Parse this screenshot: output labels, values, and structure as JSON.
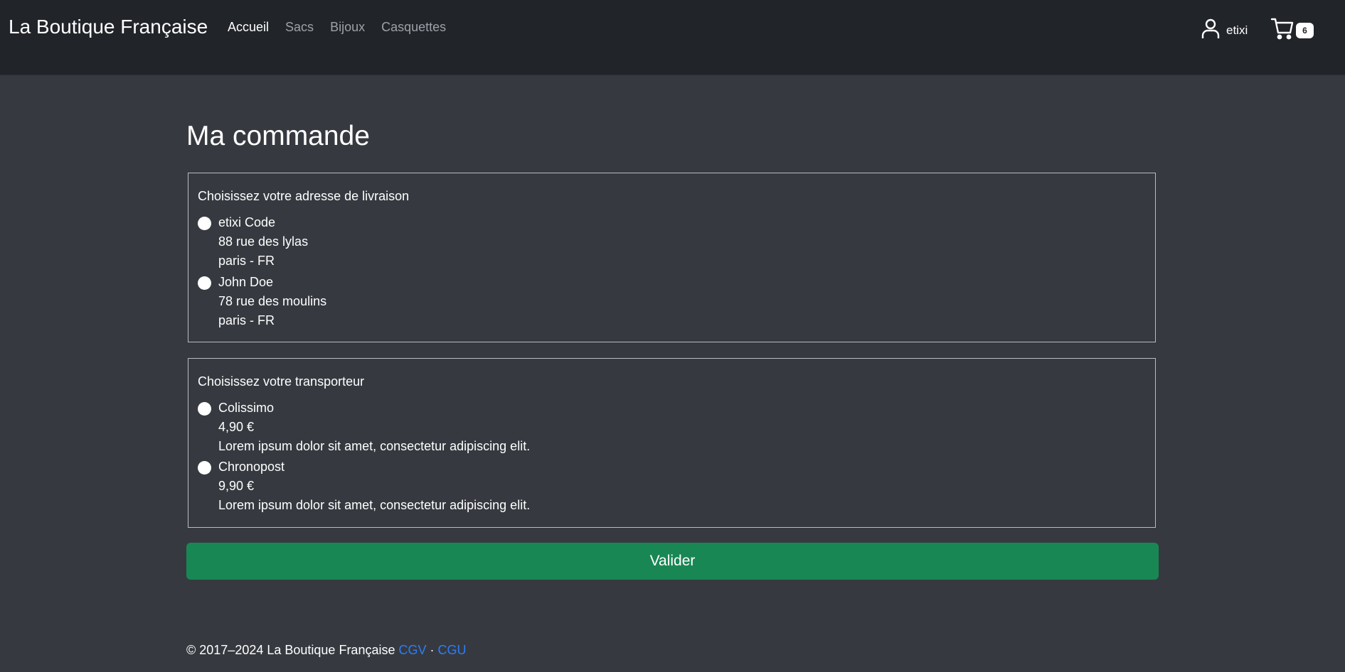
{
  "navbar": {
    "brand": "La Boutique Française",
    "links": [
      "Accueil",
      "Sacs",
      "Bijoux",
      "Casquettes"
    ],
    "account_name": "etixi",
    "cart_count": "6"
  },
  "main": {
    "title": "Ma commande",
    "address_section": {
      "label": "Choisissez votre adresse de livraison",
      "options": [
        {
          "line1": "etixi Code",
          "line2": "88 rue des lylas",
          "line3": "paris - FR"
        },
        {
          "line1": "John Doe",
          "line2": "78 rue des moulins",
          "line3": "paris - FR"
        }
      ]
    },
    "carrier_section": {
      "label": "Choisissez votre transporteur",
      "options": [
        {
          "name": "Colissimo",
          "price": "4,90 €",
          "description": "Lorem ipsum dolor sit amet, consectetur adipiscing elit."
        },
        {
          "name": "Chronopost",
          "price": "9,90 €",
          "description": "Lorem ipsum dolor sit amet, consectetur adipiscing elit."
        }
      ]
    },
    "submit_label": "Valider"
  },
  "footer": {
    "copyright": "© 2017–2024 La Boutique Française",
    "cgv": "CGV",
    "separator": "·",
    "cgu": "CGU"
  },
  "colors": {
    "background": "#363a40",
    "navbar": "#212429",
    "button": "#198754",
    "link": "#2e7cf6"
  }
}
